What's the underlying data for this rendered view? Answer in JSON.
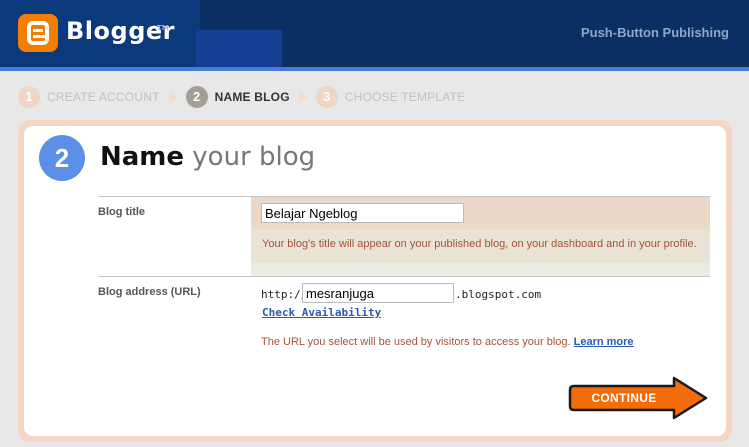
{
  "header": {
    "logo_text": "Blogger",
    "logo_tm": "TM",
    "tagline": "Push-Button Publishing"
  },
  "steps": [
    {
      "num": "1",
      "label": "CREATE ACCOUNT",
      "active": false
    },
    {
      "num": "2",
      "label": "NAME BLOG",
      "active": true
    },
    {
      "num": "3",
      "label": "CHOOSE TEMPLATE",
      "active": false
    }
  ],
  "main": {
    "step_num": "2",
    "title_strong": "Name",
    "title_light": "your blog"
  },
  "form": {
    "blog_title_label": "Blog title",
    "blog_title_value": "Belajar Ngeblog",
    "blog_title_hint": "Your blog's title will appear on your published blog, on your dashboard and in your profile.",
    "blog_address_label": "Blog address (URL)",
    "url_prefix": "http://",
    "url_value": "mesranjuga",
    "url_suffix": ".blogspot.com",
    "check_availability": "Check Availability",
    "url_note": "The URL you select will be used by visitors to access your blog.",
    "learn_more": "Learn more"
  },
  "continue_label": "CONTINUE",
  "colors": {
    "header_bg": "#0a3570",
    "accent_orange": "#f57d00",
    "step_circle": "#5b8fe8",
    "card_border": "#f4d6c5"
  }
}
